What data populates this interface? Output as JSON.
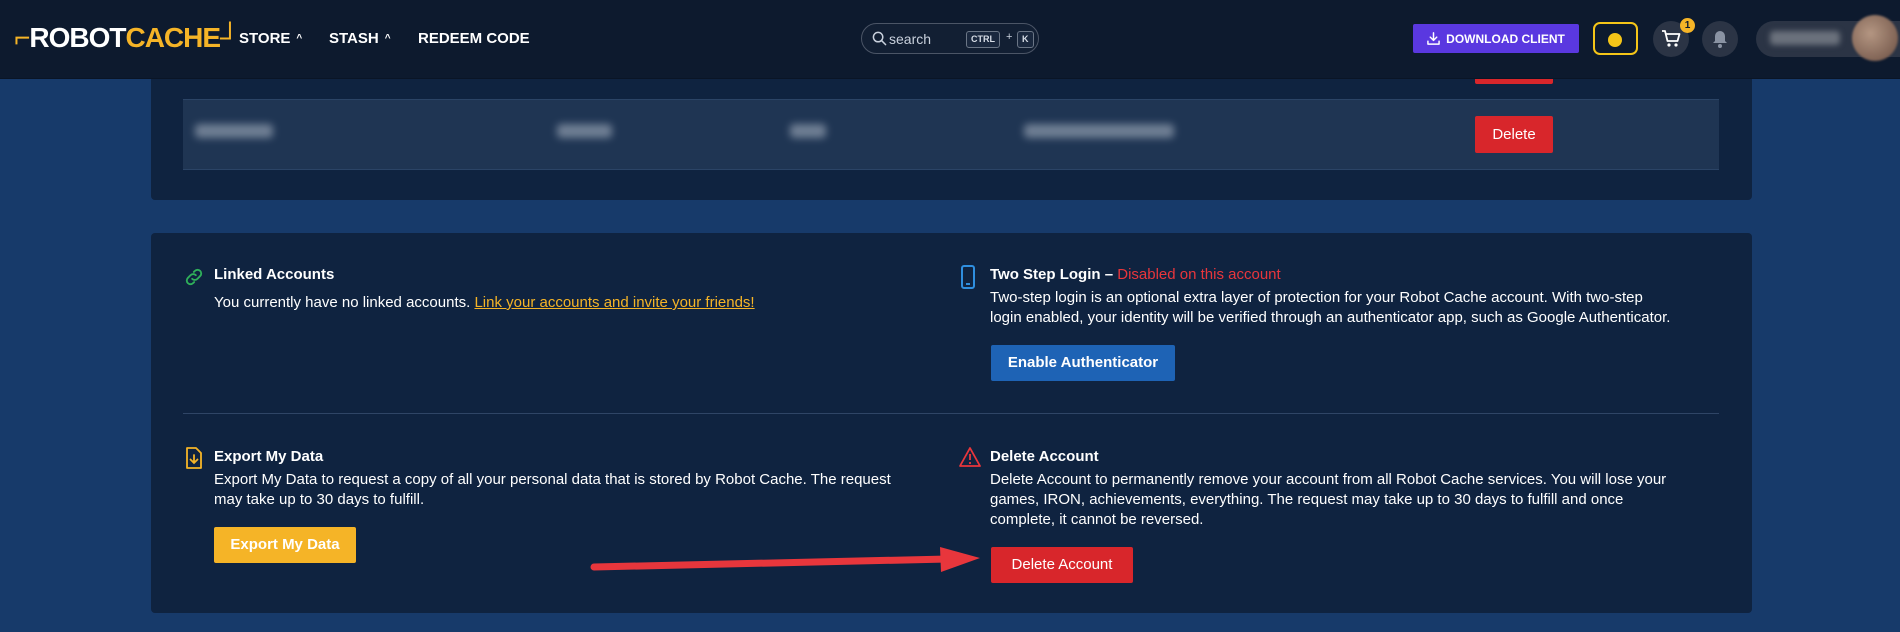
{
  "header": {
    "logo_part1": "ROBOT",
    "logo_part2": "CACHE",
    "nav": [
      {
        "label": "STORE"
      },
      {
        "label": "STASH"
      },
      {
        "label": "REDEEM CODE"
      }
    ],
    "search_placeholder": "search",
    "shortcut_ctrl": "CTRL",
    "shortcut_plus": "+",
    "shortcut_key": "K",
    "download_label": "DOWNLOAD CLIENT",
    "cart_count": "1",
    "icons": {
      "search": "search-icon",
      "download": "download-icon",
      "coin": "iron-coin-icon",
      "cart": "cart-icon",
      "bell": "bell-icon"
    }
  },
  "sessions": {
    "row_delete_label": "Delete"
  },
  "linked_accounts": {
    "title": "Linked Accounts",
    "text": "You currently have no linked accounts.",
    "link": "Link your accounts and invite your friends!"
  },
  "two_step": {
    "title": "Two Step Login",
    "dash": "–",
    "status": "Disabled on this account",
    "line1": "Two-step login is an optional extra layer of protection for your Robot Cache account. With two-step",
    "line2": "login enabled, your identity will be verified through an authenticator app, such as Google Authenticator.",
    "button": "Enable Authenticator"
  },
  "export_data": {
    "title": "Export My Data",
    "line1": "Export My Data to request a copy of all your personal data that is stored by Robot Cache. The request",
    "line2": "may take up to 30 days to fulfill.",
    "button": "Export My Data"
  },
  "delete_account": {
    "title": "Delete Account",
    "line1": "Delete Account to permanently remove your account from all Robot Cache services. You will lose your",
    "line2": "games, IRON, achievements, everything. The request may take up to 30 days to fulfill and once",
    "line3": "complete, it cannot be reversed.",
    "button": "Delete Account"
  },
  "colors": {
    "page_bg": "#173a6a",
    "header_bg": "#0d1a2e",
    "card_bg": "#0f2340",
    "accent_yellow": "#f5b427",
    "danger_red": "#d8262b",
    "primary_blue": "#1e63b5",
    "download_purple": "#5a38e0"
  }
}
